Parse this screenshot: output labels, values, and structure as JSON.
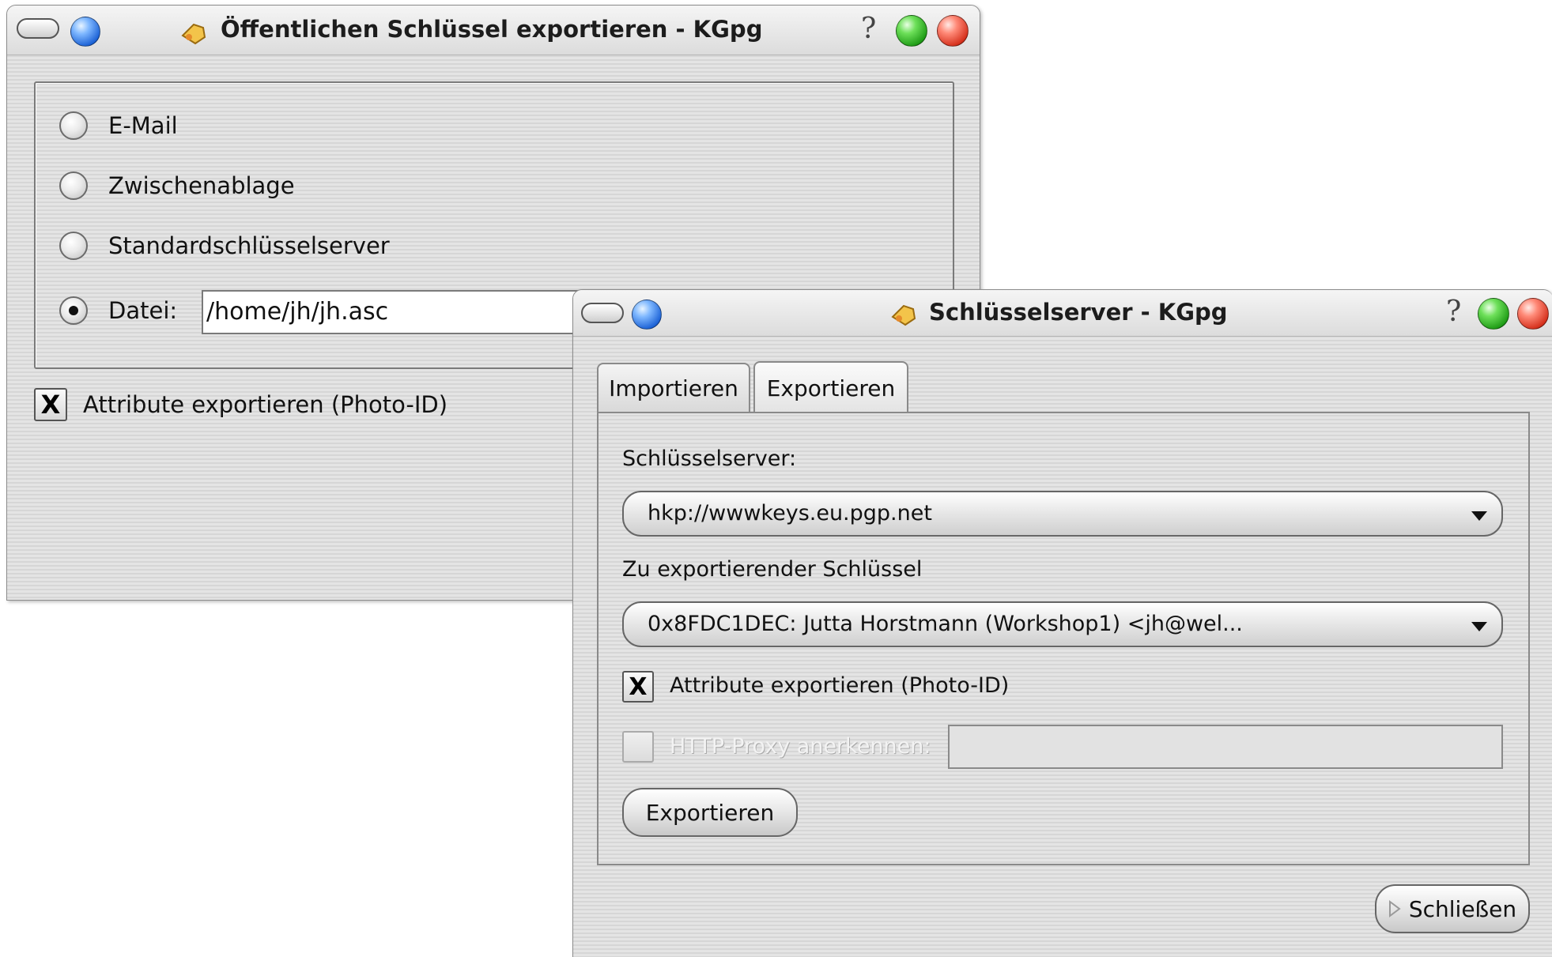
{
  "export_dialog": {
    "title": "Öffentlichen Schlüssel exportieren - KGpg",
    "help": "?",
    "options": [
      {
        "label": "E-Mail",
        "selected": false
      },
      {
        "label": "Zwischenablage",
        "selected": false
      },
      {
        "label": "Standardschlüsselserver",
        "selected": false
      },
      {
        "label": "Datei:",
        "selected": true
      }
    ],
    "file_path": "/home/jh/jh.asc",
    "attributes_checkbox": {
      "label": "Attribute exportieren (Photo-ID)",
      "checked": true,
      "mark": "X"
    }
  },
  "keyserver_dialog": {
    "title": "Schlüsselserver - KGpg",
    "help": "?",
    "tabs": [
      {
        "label": "Importieren",
        "active": false
      },
      {
        "label": "Exportieren",
        "active": true
      }
    ],
    "keyserver_label": "Schlüsselserver:",
    "keyserver_value": "hkp://wwwkeys.eu.pgp.net",
    "key_label": "Zu exportierender Schlüssel",
    "key_value": "0x8FDC1DEC: Jutta Horstmann (Workshop1) <jh@wel...",
    "attributes_checkbox": {
      "label": "Attribute exportieren (Photo-ID)",
      "checked": true,
      "mark": "X"
    },
    "proxy_checkbox": {
      "label": "HTTP-Proxy anerkennen:",
      "checked": false
    },
    "proxy_value": "",
    "export_button": "Exportieren",
    "close_button": "Schließen"
  },
  "icons": {
    "window_menu": "window-menu-pill-icon",
    "shade": "blue-orb-icon",
    "maximize": "green-orb-icon",
    "close": "red-orb-icon",
    "app": "kgpg-key-icon"
  }
}
